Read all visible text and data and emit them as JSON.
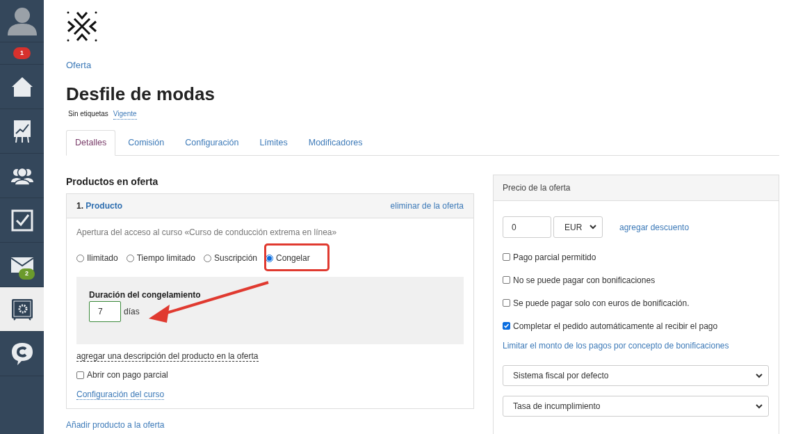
{
  "sidebar": {
    "items": [
      {
        "kind": "avatar",
        "selected": false
      },
      {
        "kind": "badge",
        "badge": "1",
        "selected": false
      },
      {
        "kind": "home",
        "selected": false
      },
      {
        "kind": "chart",
        "selected": false
      },
      {
        "kind": "users",
        "selected": false
      },
      {
        "kind": "tasks",
        "selected": false
      },
      {
        "kind": "mail",
        "badge": "2",
        "selected": false
      },
      {
        "kind": "safe",
        "selected": true
      },
      {
        "kind": "chat",
        "selected": false
      }
    ]
  },
  "breadcrumb": "Oferta",
  "title": "Desfile de modas",
  "tags": {
    "label": "Sin etiquetas",
    "status": "Vigente"
  },
  "tabs": [
    {
      "label": "Detalles",
      "selected": true
    },
    {
      "label": "Comisión",
      "selected": false
    },
    {
      "label": "Configuración",
      "selected": false
    },
    {
      "label": "Límites",
      "selected": false
    },
    {
      "label": "Modificadores",
      "selected": false
    }
  ],
  "products": {
    "heading": "Productos en oferta",
    "number": "1.",
    "name": "Producto",
    "remove": "eliminar de la oferta",
    "description": "Apertura del acceso al curso «Curso de conducción extrema en línea»",
    "options": [
      {
        "label": "Ilimitado",
        "selected": false
      },
      {
        "label": "Tiempo limitado",
        "selected": false
      },
      {
        "label": "Suscripción",
        "selected": false
      },
      {
        "label": "Congelar",
        "selected": true
      }
    ],
    "freeze": {
      "label": "Duración del congelamiento",
      "value": "7",
      "unit": "días"
    },
    "add_description": "agregar una descripción del producto en la oferta",
    "partial": {
      "label": "Abrir con pago parcial",
      "checked": false
    },
    "course_settings": "Configuración del curso",
    "add_product": "Añadir producto a la oferta"
  },
  "price": {
    "heading": "Precio de la oferta",
    "value": "0",
    "currency": "EUR",
    "discount": "agregar descuento",
    "options": [
      {
        "label": "Pago parcial permitido",
        "checked": false
      },
      {
        "label": "No se puede pagar con bonificaciones",
        "checked": false
      },
      {
        "label": "Se puede pagar solo con euros de bonificación.",
        "checked": false
      },
      {
        "label": "Completar el pedido automáticamente al recibir el pago",
        "checked": true
      }
    ],
    "limit_link": "Limitar el monto de los pagos por concepto de bonificaciones",
    "selects": [
      "Sistema fiscal por defecto",
      "Tasa de incumplimiento"
    ]
  }
}
